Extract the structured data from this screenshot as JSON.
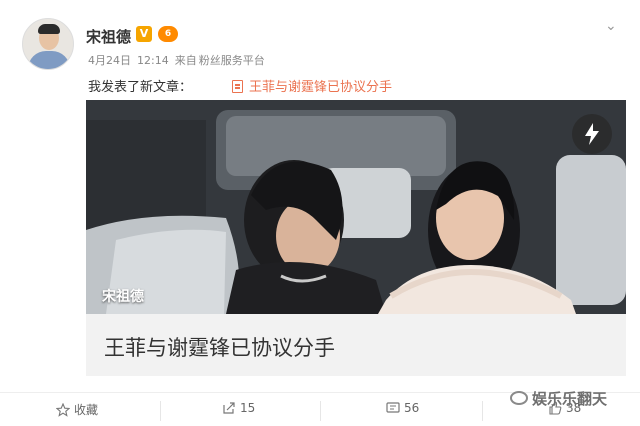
{
  "user": {
    "name": "宋祖德",
    "verified_badge": "V",
    "level_badge": "6"
  },
  "meta": {
    "date": "4月24日",
    "time": "12:14",
    "source_prefix": "来自",
    "source": "粉丝服务平台"
  },
  "post": {
    "text": "我发表了新文章：",
    "link_text": "王菲与谢霆锋已协议分手"
  },
  "card": {
    "photo_author": "宋祖德",
    "title": "王菲与谢霆锋已协议分手"
  },
  "actions": {
    "favorite_label": "收藏",
    "repost_count": "15",
    "comment_count": "56",
    "like_count": "38"
  },
  "watermark": "娱乐乐翻天",
  "icons": [
    "avatar",
    "chevron-down-icon",
    "document-icon",
    "flash-icon",
    "star-icon",
    "repost-icon",
    "comment-icon",
    "like-icon",
    "wechat-icon"
  ],
  "colors": {
    "link": "#eb7350",
    "badge_v": "#f6a500",
    "badge_level": "#ff8a00"
  }
}
